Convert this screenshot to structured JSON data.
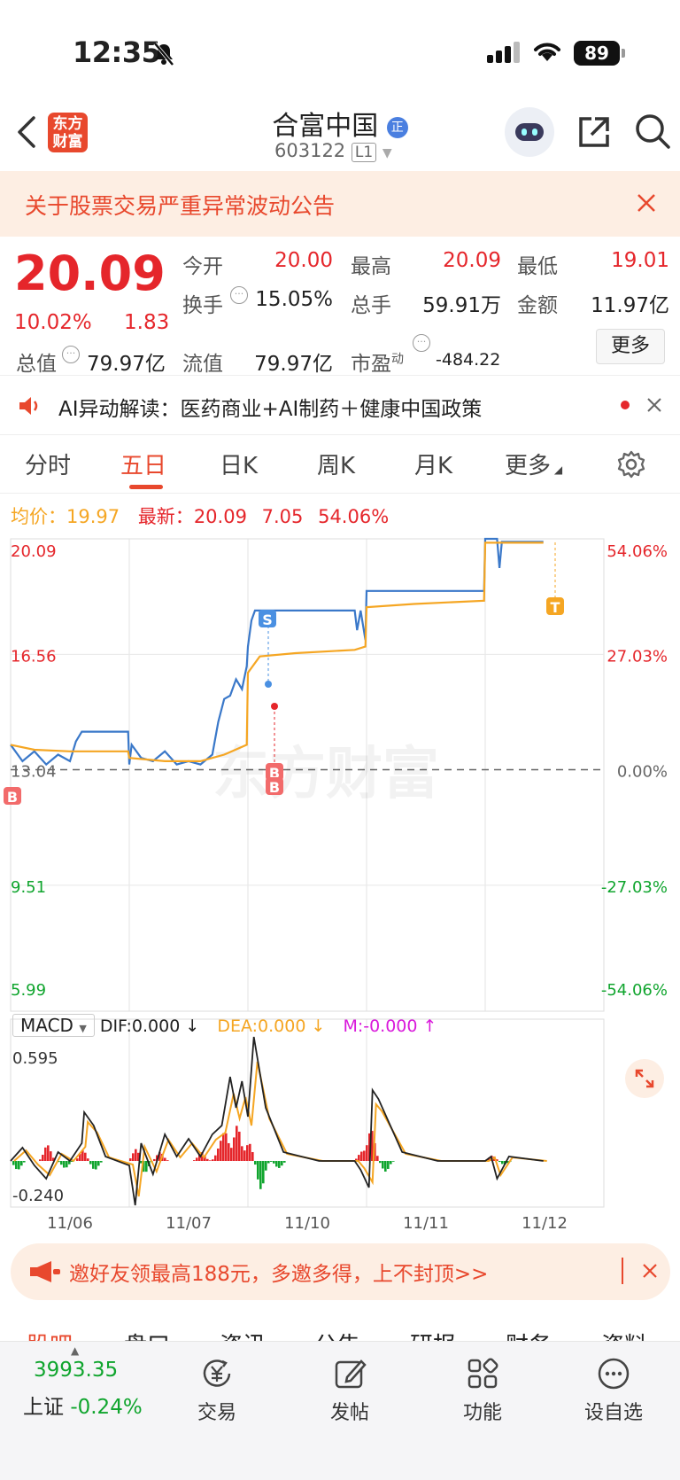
{
  "status": {
    "time": "12:35",
    "battery": "89"
  },
  "header": {
    "logo_line1": "东方",
    "logo_line2": "财富",
    "stock_name": "合富中国",
    "badge": "正",
    "stock_code": "603122",
    "level": "L1"
  },
  "notice": {
    "text": "关于股票交易严重异常波动公告"
  },
  "quote": {
    "price": "20.09",
    "change_pct": "10.02%",
    "change": "1.83",
    "open_label": "今开",
    "open": "20.00",
    "high_label": "最高",
    "high": "20.09",
    "low_label": "最低",
    "low": "19.01",
    "turnover_label": "换手",
    "turnover": "15.05%",
    "volume_label": "总手",
    "volume": "59.91万",
    "amount_label": "金额",
    "amount": "11.97亿",
    "mktcap_label": "总值",
    "mktcap": "79.97亿",
    "float_label": "流值",
    "float_cap": "79.97亿",
    "pe_label": "市盈",
    "pe_sup": "动",
    "pe": "-484.22",
    "more": "更多"
  },
  "ai_bar": {
    "text": "AI异动解读：医药商业+AI制药＋健康中国政策"
  },
  "tabs": [
    "分时",
    "五日",
    "日K",
    "周K",
    "月K",
    "更多"
  ],
  "active_tab": 1,
  "price_info": {
    "avg_label": "均价：",
    "avg": "19.97",
    "latest_label": "最新：",
    "latest": "20.09",
    "chg": "7.05",
    "pct": "54.06%"
  },
  "chart_data": {
    "type": "line",
    "title": "",
    "x_dates": [
      "11/06",
      "11/07",
      "11/10",
      "11/11",
      "11/12"
    ],
    "y_left_ticks": [
      "20.09",
      "16.56",
      "13.04",
      "9.51",
      "5.99"
    ],
    "y_right_ticks": [
      "54.06%",
      "27.03%",
      "0.00%",
      "-27.03%",
      "-54.06%"
    ],
    "ylim": [
      5.99,
      20.09
    ],
    "prev_close": 13.04,
    "series": [
      {
        "name": "price",
        "color": "#3a78c9",
        "points": [
          [
            0,
            13.8
          ],
          [
            0.1,
            13.3
          ],
          [
            0.2,
            13.6
          ],
          [
            0.3,
            13.2
          ],
          [
            0.4,
            13.5
          ],
          [
            0.5,
            13.3
          ],
          [
            0.55,
            13.9
          ],
          [
            0.6,
            14.2
          ],
          [
            0.8,
            14.2
          ],
          [
            0.99,
            14.2
          ],
          [
            1.0,
            13.2
          ],
          [
            1.02,
            13.8
          ],
          [
            1.1,
            13.4
          ],
          [
            1.2,
            13.3
          ],
          [
            1.3,
            13.6
          ],
          [
            1.4,
            13.2
          ],
          [
            1.5,
            13.3
          ],
          [
            1.6,
            13.2
          ],
          [
            1.7,
            13.5
          ],
          [
            1.75,
            14.5
          ],
          [
            1.8,
            15.2
          ],
          [
            1.85,
            15.3
          ],
          [
            1.9,
            15.8
          ],
          [
            1.95,
            15.5
          ],
          [
            1.99,
            16.2
          ],
          [
            2.0,
            16.8
          ],
          [
            2.03,
            17.6
          ],
          [
            2.06,
            17.9
          ],
          [
            2.3,
            17.9
          ],
          [
            2.5,
            17.9
          ],
          [
            2.9,
            17.9
          ],
          [
            2.92,
            17.3
          ],
          [
            2.95,
            17.9
          ],
          [
            2.99,
            17.0
          ],
          [
            3.0,
            18.5
          ],
          [
            3.3,
            18.5
          ],
          [
            3.6,
            18.5
          ],
          [
            3.99,
            18.5
          ],
          [
            4.0,
            20.09
          ],
          [
            4.1,
            20.09
          ],
          [
            4.12,
            19.2
          ],
          [
            4.14,
            20.0
          ],
          [
            4.3,
            20.0
          ],
          [
            4.49,
            20.0
          ]
        ]
      },
      {
        "name": "avg",
        "color": "#f5a623",
        "points": [
          [
            0,
            13.8
          ],
          [
            0.2,
            13.65
          ],
          [
            0.5,
            13.6
          ],
          [
            0.99,
            13.6
          ],
          [
            1.0,
            13.4
          ],
          [
            1.3,
            13.3
          ],
          [
            1.6,
            13.3
          ],
          [
            1.8,
            13.5
          ],
          [
            1.99,
            13.8
          ],
          [
            2.0,
            16.0
          ],
          [
            2.1,
            16.5
          ],
          [
            2.4,
            16.6
          ],
          [
            2.9,
            16.7
          ],
          [
            2.99,
            16.8
          ],
          [
            3.0,
            18.0
          ],
          [
            3.4,
            18.1
          ],
          [
            3.99,
            18.2
          ],
          [
            4.0,
            19.97
          ],
          [
            4.49,
            19.97
          ]
        ]
      }
    ],
    "macd": {
      "indicator": "MACD",
      "dif": "DIF:0.000",
      "dea": "DEA:0.000",
      "m": "M:-0.000",
      "y_top": "0.595",
      "y_bottom": "-0.240"
    }
  },
  "promo": {
    "text": "邀好友领最高188元，多邀多得，上不封顶>>"
  },
  "subtabs": [
    "股吧",
    "盘口",
    "资讯",
    "公告",
    "研报",
    "财务",
    "资料"
  ],
  "bottom": {
    "index_value": "3993.35",
    "index_name": "上证",
    "index_pct": "-0.24%",
    "items": [
      "交易",
      "发帖",
      "功能",
      "设自选"
    ]
  },
  "watermark": "东方财富"
}
